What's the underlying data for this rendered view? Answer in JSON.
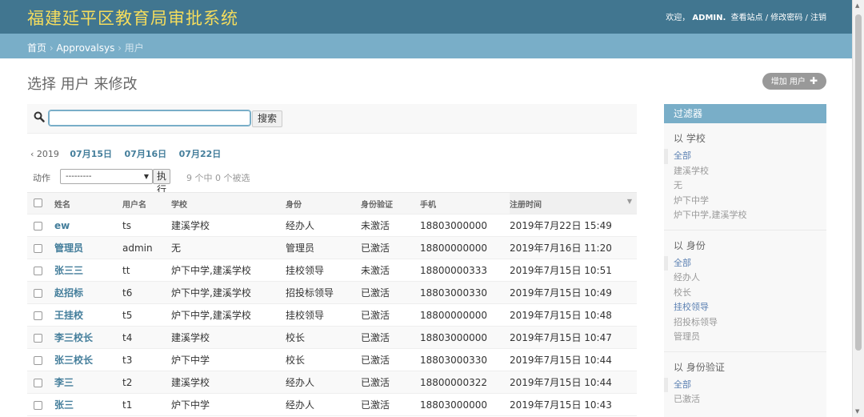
{
  "header": {
    "branding": "福建延平区教育局审批系统",
    "welcome": "欢迎，",
    "user": "ADMIN.",
    "links": [
      "查看站点",
      "修改密码",
      "注销"
    ]
  },
  "breadcrumbs": {
    "home": "首页",
    "app": "Approvalsys",
    "current": "用户"
  },
  "page": {
    "title": "选择 用户 来修改",
    "add_button": "增加 用户"
  },
  "search": {
    "value": "",
    "button": "搜索"
  },
  "date_hierarchy": {
    "back": "‹ 2019",
    "days": [
      "07月15日",
      "07月16日",
      "07月22日"
    ]
  },
  "actions": {
    "label": "动作",
    "selected": "---------",
    "go": "执行",
    "counter": "9 个中 0 个被选"
  },
  "table": {
    "headers": [
      "姓名",
      "用户名",
      "学校",
      "身份",
      "身份验证",
      "手机",
      "注册时间"
    ],
    "rows": [
      [
        "ew",
        "ts",
        "建溪学校",
        "经办人",
        "未激活",
        "18803000000",
        "2019年7月22日 15:49"
      ],
      [
        "管理员",
        "admin",
        "无",
        "管理员",
        "已激活",
        "18800000000",
        "2019年7月16日 11:20"
      ],
      [
        "张三三",
        "tt",
        "炉下中学,建溪学校",
        "挂校领导",
        "未激活",
        "18800000333",
        "2019年7月15日 10:51"
      ],
      [
        "赵招标",
        "t6",
        "炉下中学,建溪学校",
        "招投标领导",
        "已激活",
        "18803000330",
        "2019年7月15日 10:49"
      ],
      [
        "王挂校",
        "t5",
        "炉下中学,建溪学校",
        "挂校领导",
        "已激活",
        "18800000000",
        "2019年7月15日 10:48"
      ],
      [
        "李三校长",
        "t4",
        "建溪学校",
        "校长",
        "已激活",
        "18803000000",
        "2019年7月15日 10:47"
      ],
      [
        "张三校长",
        "t3",
        "炉下中学",
        "校长",
        "已激活",
        "18803000330",
        "2019年7月15日 10:44"
      ],
      [
        "李三",
        "t2",
        "建溪学校",
        "经办人",
        "已激活",
        "18800000322",
        "2019年7月15日 10:44"
      ],
      [
        "张三",
        "t1",
        "炉下中学",
        "经办人",
        "已激活",
        "18803000000",
        "2019年7月15日 10:43"
      ]
    ]
  },
  "filter": {
    "title": "过滤器",
    "groups": [
      {
        "title": "以 学校",
        "items": [
          "全部",
          "建溪学校",
          "无",
          "炉下中学",
          "炉下中学,建溪学校"
        ],
        "selected": 0
      },
      {
        "title": "以 身份",
        "items": [
          "全部",
          "经办人",
          "校长",
          "挂校领导",
          "招投标领导",
          "管理员"
        ],
        "selected": 0,
        "bold": 3
      },
      {
        "title": "以 身份验证",
        "items": [
          "全部",
          "已激活"
        ],
        "selected": 0
      }
    ]
  },
  "colors": {
    "header_bg": "#417690",
    "breadcrumb_bg": "#79aec8",
    "branding": "#f5dd5d",
    "link": "#447e9b"
  }
}
